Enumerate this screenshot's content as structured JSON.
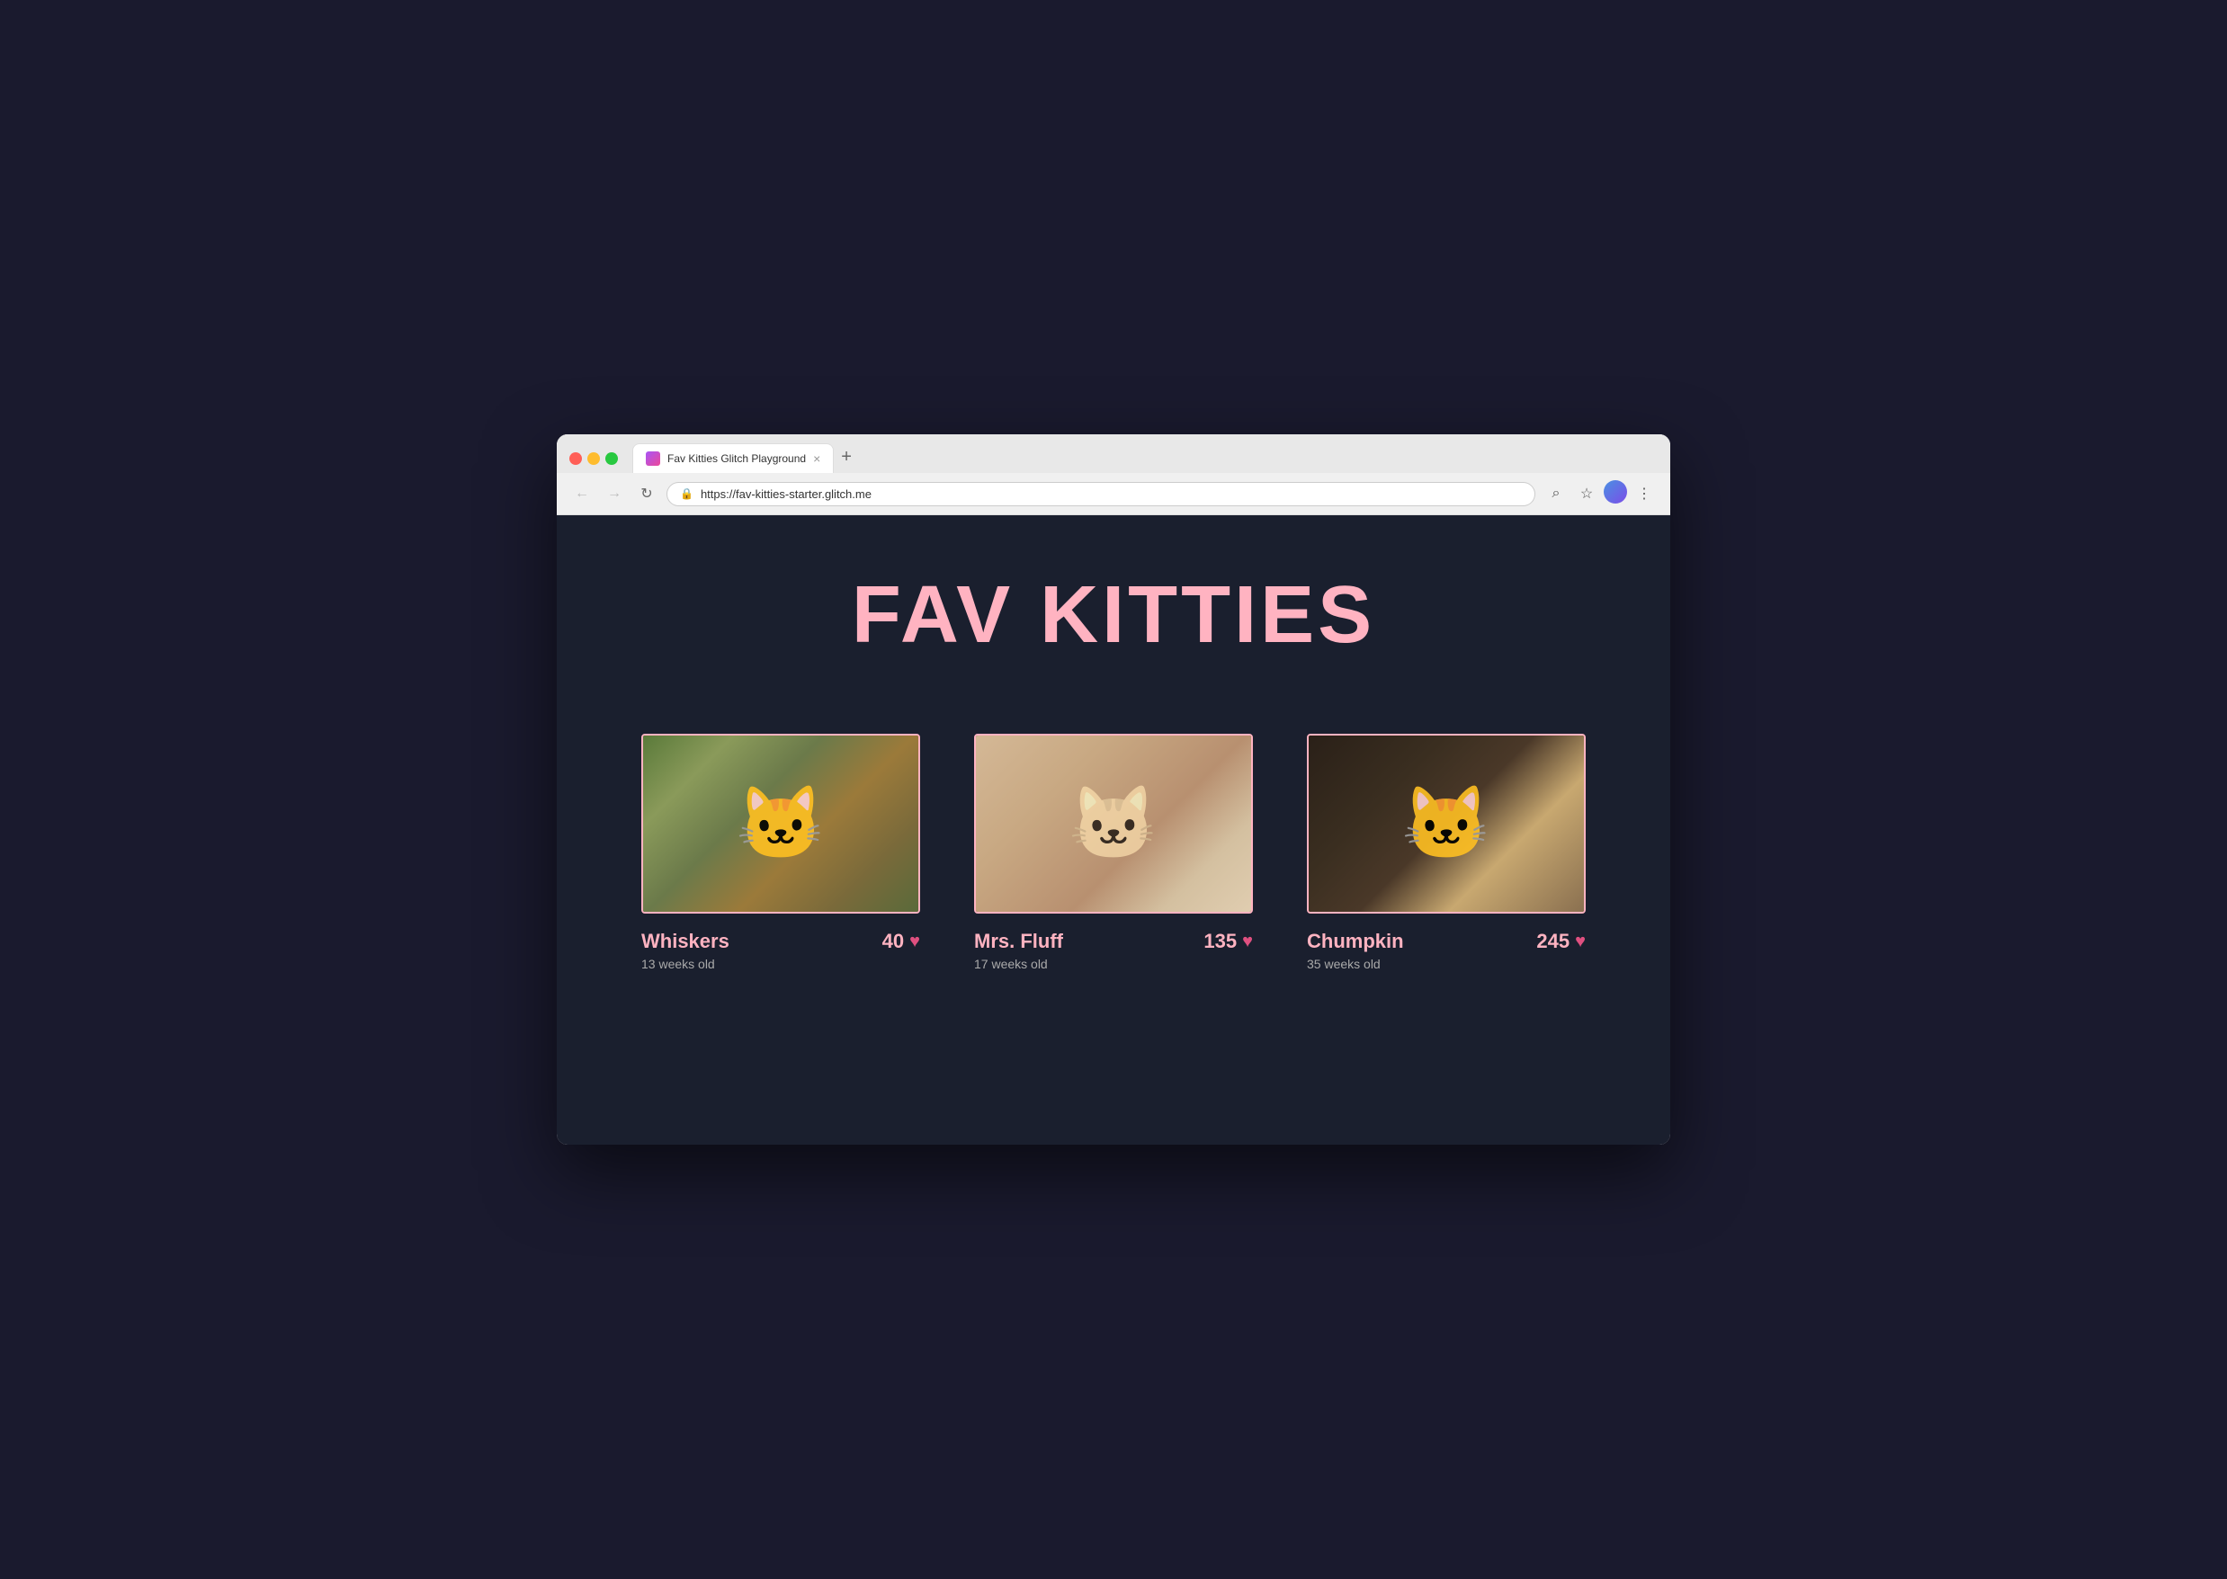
{
  "browser": {
    "tab": {
      "favicon_label": "glitch-favicon",
      "title": "Fav Kitties Glitch Playground",
      "close_label": "×"
    },
    "new_tab_label": "+",
    "nav": {
      "back_label": "←",
      "forward_label": "→",
      "reload_label": "↻"
    },
    "address": {
      "url": "https://fav-kitties-starter.glitch.me",
      "lock_symbol": "🔒"
    },
    "actions": {
      "search_label": "⌕",
      "bookmark_label": "☆",
      "menu_label": "⋮"
    }
  },
  "page": {
    "title": "FAV KITTIES",
    "kitties": [
      {
        "id": "whiskers",
        "name": "Whiskers",
        "age": "13 weeks old",
        "votes": "40",
        "image_class": "cat-img-1"
      },
      {
        "id": "mrs-fluff",
        "name": "Mrs. Fluff",
        "age": "17 weeks old",
        "votes": "135",
        "image_class": "cat-img-2"
      },
      {
        "id": "chumpkin",
        "name": "Chumpkin",
        "age": "35 weeks old",
        "votes": "245",
        "image_class": "cat-img-3"
      }
    ],
    "heart_symbol": "♥"
  }
}
